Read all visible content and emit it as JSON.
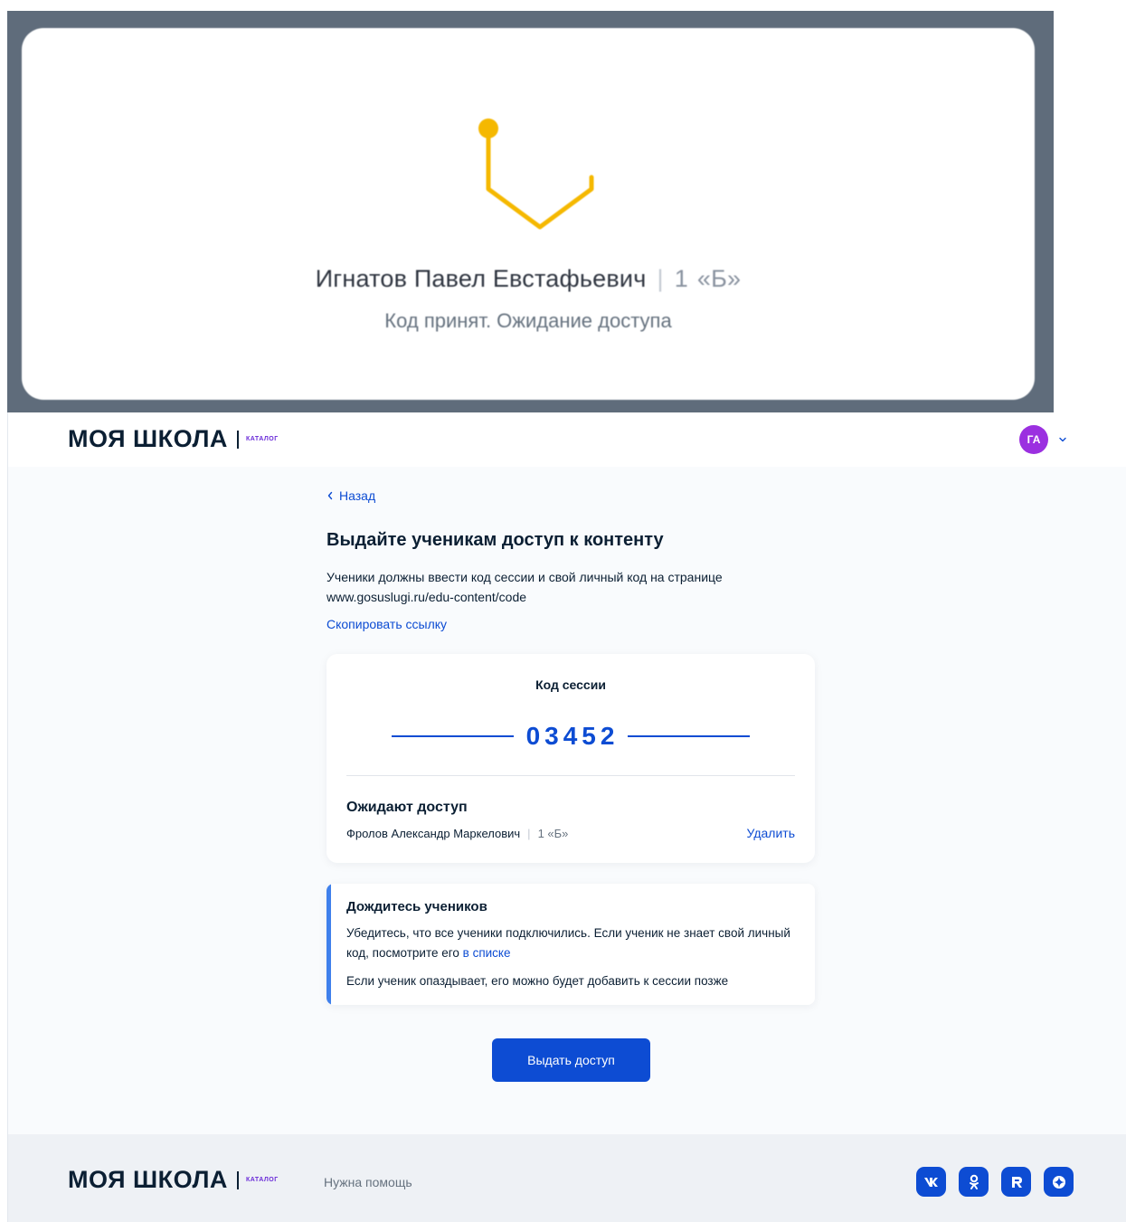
{
  "overlay": {
    "student_name": "Игнатов Павел Евстафьевич",
    "separator": "|",
    "class_number": "1",
    "class_letter": "«Б»",
    "status": "Код принят. Ожидание доступа",
    "loader_color": "#f5b800"
  },
  "header": {
    "logo_main": "МОЯ ШКОЛА",
    "logo_sub": "КАТАЛОГ",
    "avatar_initials": "ГА",
    "avatar_color": "#9b30e0"
  },
  "main": {
    "back_label": "Назад",
    "title": "Выдайте ученикам доступ к контенту",
    "description": "Ученики должны ввести код сессии и свой личный код на странице www.gosuslugi.ru/edu-content/code",
    "copy_link_label": "Скопировать ссылку",
    "session": {
      "label": "Код сессии",
      "code": "03452"
    },
    "waiting": {
      "title": "Ожидают доступ",
      "items": [
        {
          "name": "Фролов Александр Маркелович",
          "separator": "|",
          "class": "1 «Б»",
          "action": "Удалить"
        }
      ]
    },
    "info": {
      "title": "Дождитесь учеников",
      "text_before_link": "Убедитесь, что все ученики подключились. Если ученик не знает свой личный код, посмотрите его ",
      "link": "в списке",
      "text2": "Если ученик опаздывает, его можно будет добавить к сессии позже"
    },
    "primary_button": "Выдать доступ"
  },
  "footer": {
    "logo_main": "МОЯ ШКОЛА",
    "logo_sub": "КАТАЛОГ",
    "help_label": "Нужна помощь",
    "social_icons": [
      "vk-icon",
      "odnoklassniki-icon",
      "rutube-icon",
      "dzen-icon"
    ]
  },
  "colors": {
    "accent": "#0d4cd3",
    "info_bar": "#3f80ec",
    "overlay_bg": "#5f6c7b",
    "page_bg": "#f9fbfd",
    "footer_bg": "#eef1f5"
  }
}
